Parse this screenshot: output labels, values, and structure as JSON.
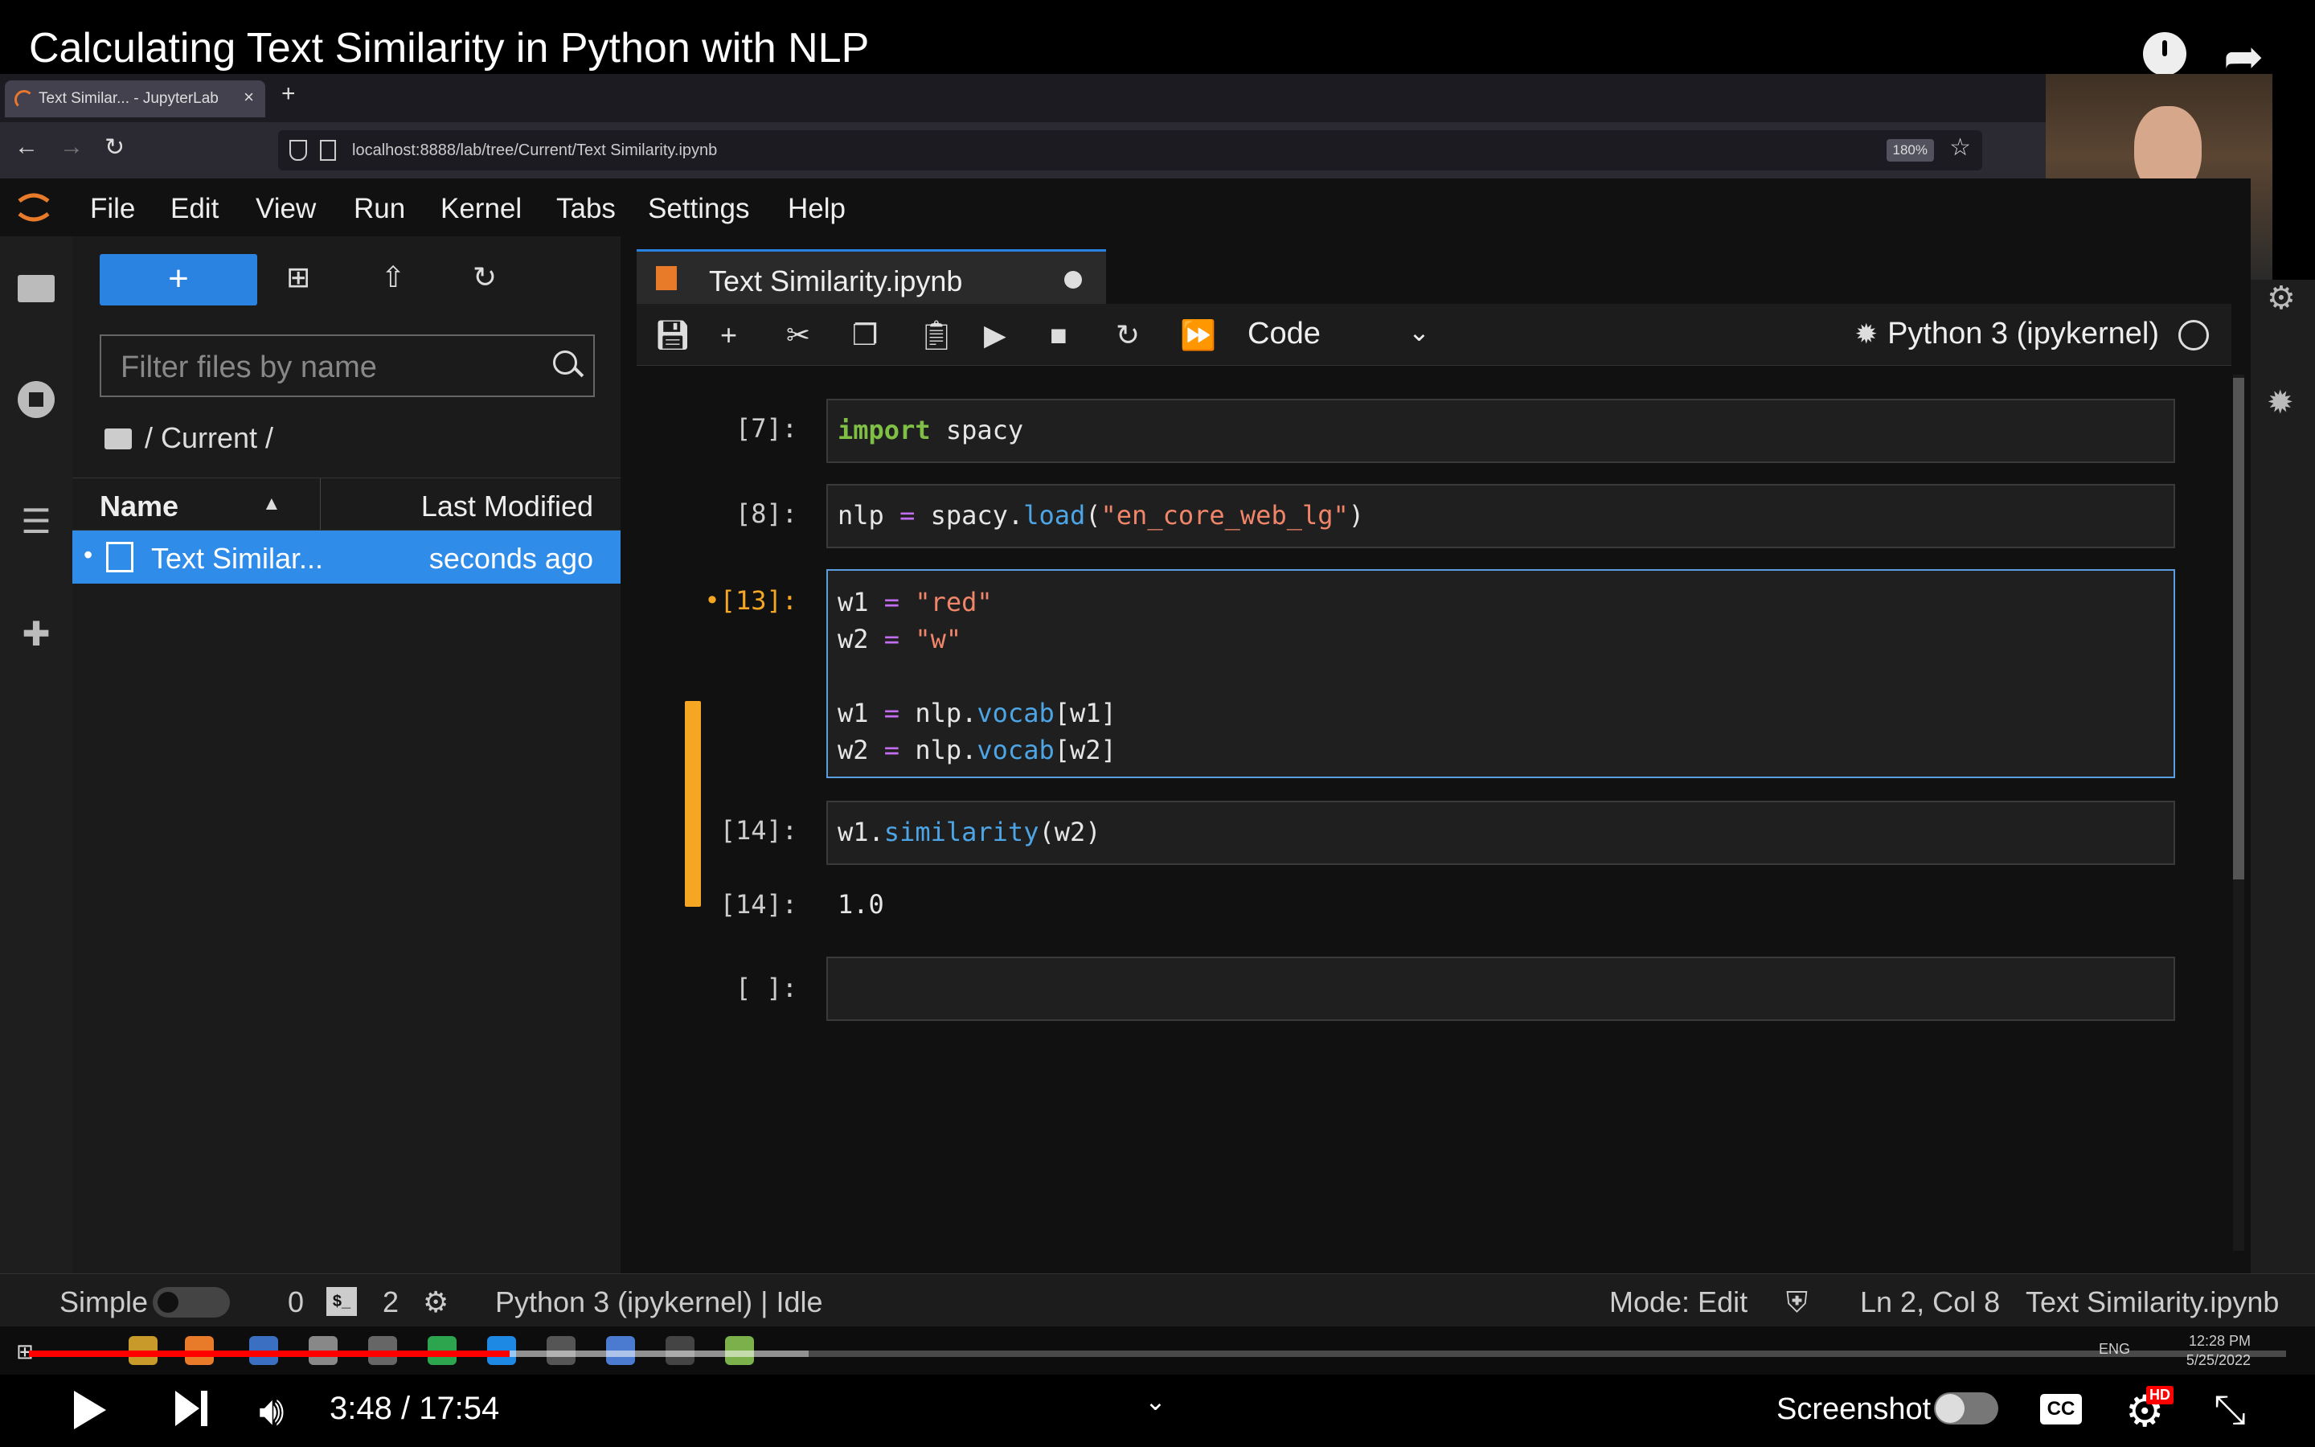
{
  "video": {
    "title": "Calculating Text Similarity in Python with NLP",
    "time": "3:48 / 17:54",
    "progress_fraction": 0.2128,
    "screenshot_label": "Screenshot",
    "cc_label": "CC",
    "hd_badge": "HD"
  },
  "browser": {
    "tab_title": "Text Similar... - JupyterLab",
    "tab_close": "×",
    "new_tab": "+",
    "url": "localhost:8888/lab/tree/Current/Text Similarity.ipynb",
    "zoom": "180%"
  },
  "menu": [
    "File",
    "Edit",
    "View",
    "Run",
    "Kernel",
    "Tabs",
    "Settings",
    "Help"
  ],
  "filebrowser": {
    "new_label": "+",
    "filter_placeholder": "Filter files by name",
    "breadcrumb": "/ Current /",
    "col_name": "Name",
    "col_modified": "Last Modified",
    "files": [
      {
        "name": "Text Similar...",
        "modified": "seconds ago"
      }
    ]
  },
  "notebook": {
    "tab_title": "Text Similarity.ipynb",
    "cell_type": "Code",
    "kernel": "Python 3 (ipykernel)",
    "cells": [
      {
        "prompt": "[7]:",
        "code": "import spacy"
      },
      {
        "prompt": "[8]:",
        "code": "nlp = spacy.load(\"en_core_web_lg\")"
      },
      {
        "prompt": "•[13]:",
        "code": "w1 = \"red\"\nw2 = \"w\"\n\nw1 = nlp.vocab[w1]\nw2 = nlp.vocab[w2]"
      },
      {
        "prompt": "[14]:",
        "code": "w1.similarity(w2)"
      },
      {
        "prompt": "[14]:",
        "output": "1.0"
      },
      {
        "prompt": "[ ]:",
        "code": ""
      }
    ]
  },
  "statusbar": {
    "mode_simple": "Simple",
    "count_a": "0",
    "term_label": "$_",
    "count_b": "2",
    "kernel_status": "Python 3 (ipykernel) | Idle",
    "mode": "Mode: Edit",
    "cursor": "Ln 2, Col 8",
    "filename": "Text Similarity.ipynb"
  },
  "taskbar": {
    "lang": "ENG",
    "clock_time": "12:28 PM",
    "clock_date": "5/25/2022"
  },
  "colors": {
    "accent_blue": "#2a83e0",
    "active_cell_marker": "#f5a623",
    "progress_red": "#ff0000"
  }
}
